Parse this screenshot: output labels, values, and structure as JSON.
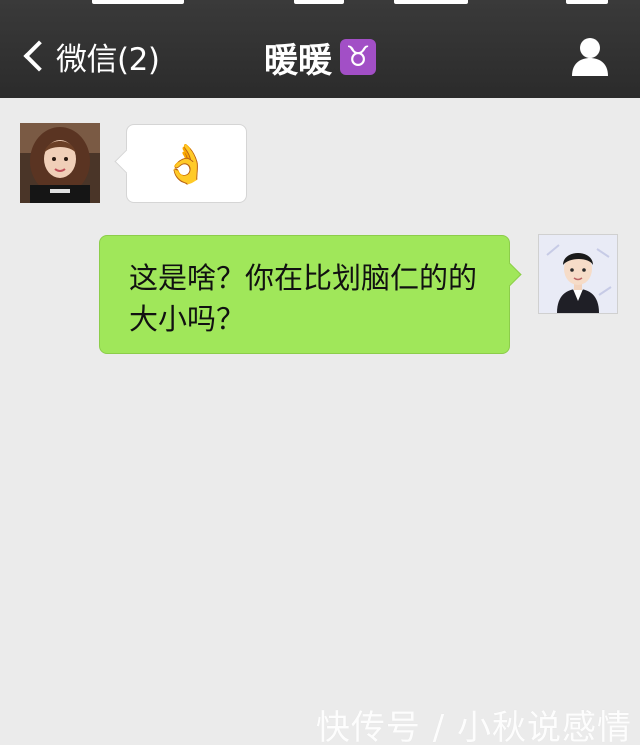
{
  "navbar": {
    "back_label": "微信(2)",
    "title": "暖暖",
    "title_badge_icon": "taurus-icon",
    "profile_icon": "person-icon",
    "background": "#2f2f2f"
  },
  "messages": [
    {
      "direction": "incoming",
      "sender_avatar": "girl-photo-avatar",
      "content_type": "emoji",
      "emoji": "👌",
      "bubble_color": "#ffffff"
    },
    {
      "direction": "outgoing",
      "sender_avatar": "cartoon-man-avatar",
      "content_type": "text",
      "text": "这是啥？你在比划脑仁的的大小吗？",
      "bubble_color": "#a0e75a"
    }
  ],
  "watermark": "快传号 / 小秋说感情"
}
